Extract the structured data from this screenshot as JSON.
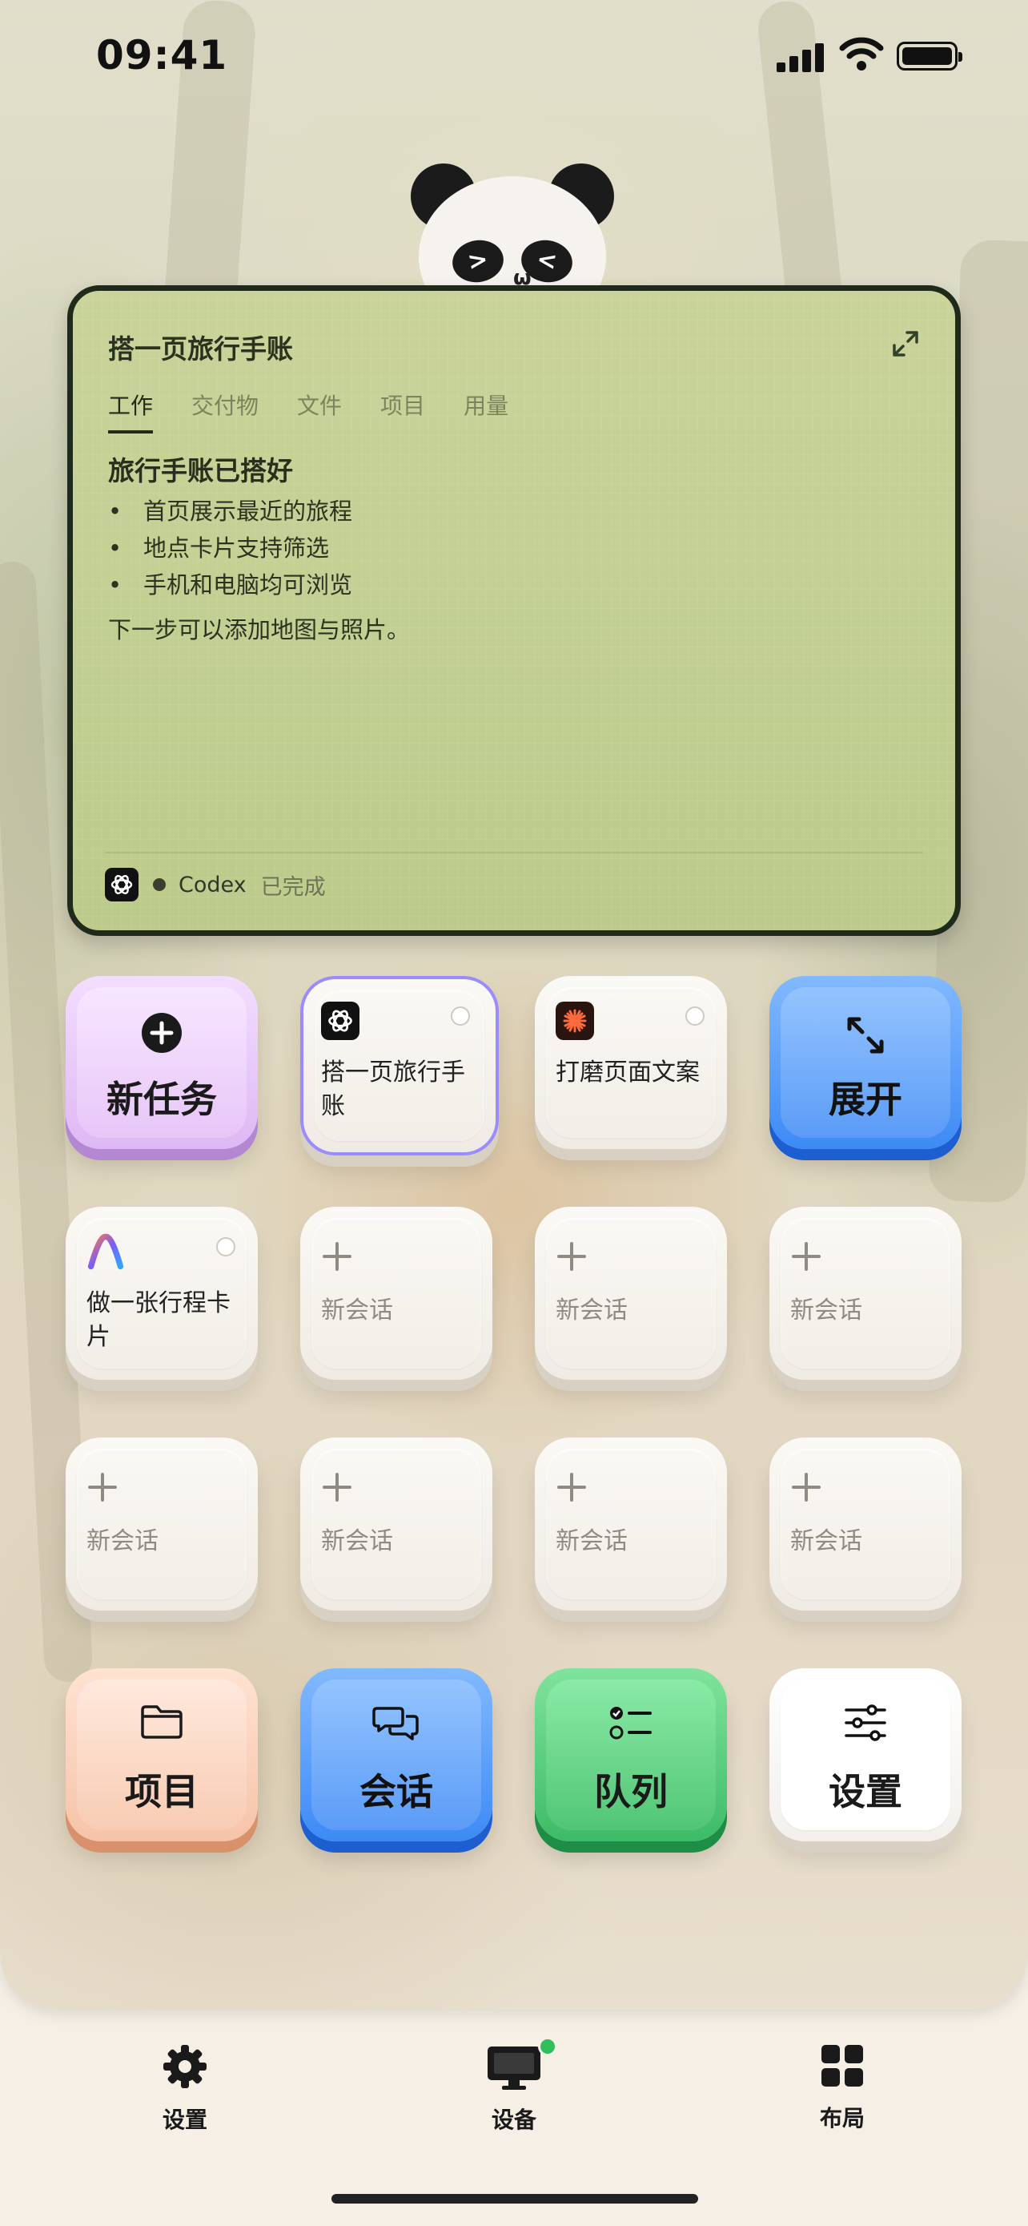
{
  "status_bar": {
    "time": "09:41"
  },
  "card": {
    "title": "搭一页旅行手账",
    "tabs": [
      "工作",
      "交付物",
      "文件",
      "项目",
      "用量"
    ],
    "content_title": "旅行手账已搭好",
    "bullets": [
      "首页展示最近的旅程",
      "地点卡片支持筛选",
      "手机和电脑均可浏览"
    ],
    "next_step": "下一步可以添加地图与照片。",
    "agent_name": "Codex",
    "agent_status": "已完成"
  },
  "tiles": {
    "new_task": "新任务",
    "session_1": "搭一页旅行手账",
    "session_2": "打磨页面文案",
    "expand": "展开",
    "session_3": "做一张行程卡片",
    "new_session": "新会话",
    "projects": "项目",
    "sessions": "会话",
    "queue": "队列",
    "settings": "设置"
  },
  "bottom_nav": {
    "settings": "设置",
    "devices": "设备",
    "layout": "布局"
  },
  "colors": {
    "card_bg": "#c4cf93",
    "purple": "#e6c3f7",
    "blue": "#4f95f6",
    "peach": "#f7c9b0",
    "green": "#47c16d",
    "status_dot": "#2fbf5b"
  },
  "icons": [
    "plus-circle-icon",
    "openai-logo-icon",
    "burst-icon",
    "expand-icon",
    "gradient-a-icon",
    "plus-icon",
    "folder-icon",
    "chat-bubbles-icon",
    "checklist-icon",
    "sliders-icon",
    "gear-icon",
    "monitor-icon",
    "grid-icon"
  ]
}
